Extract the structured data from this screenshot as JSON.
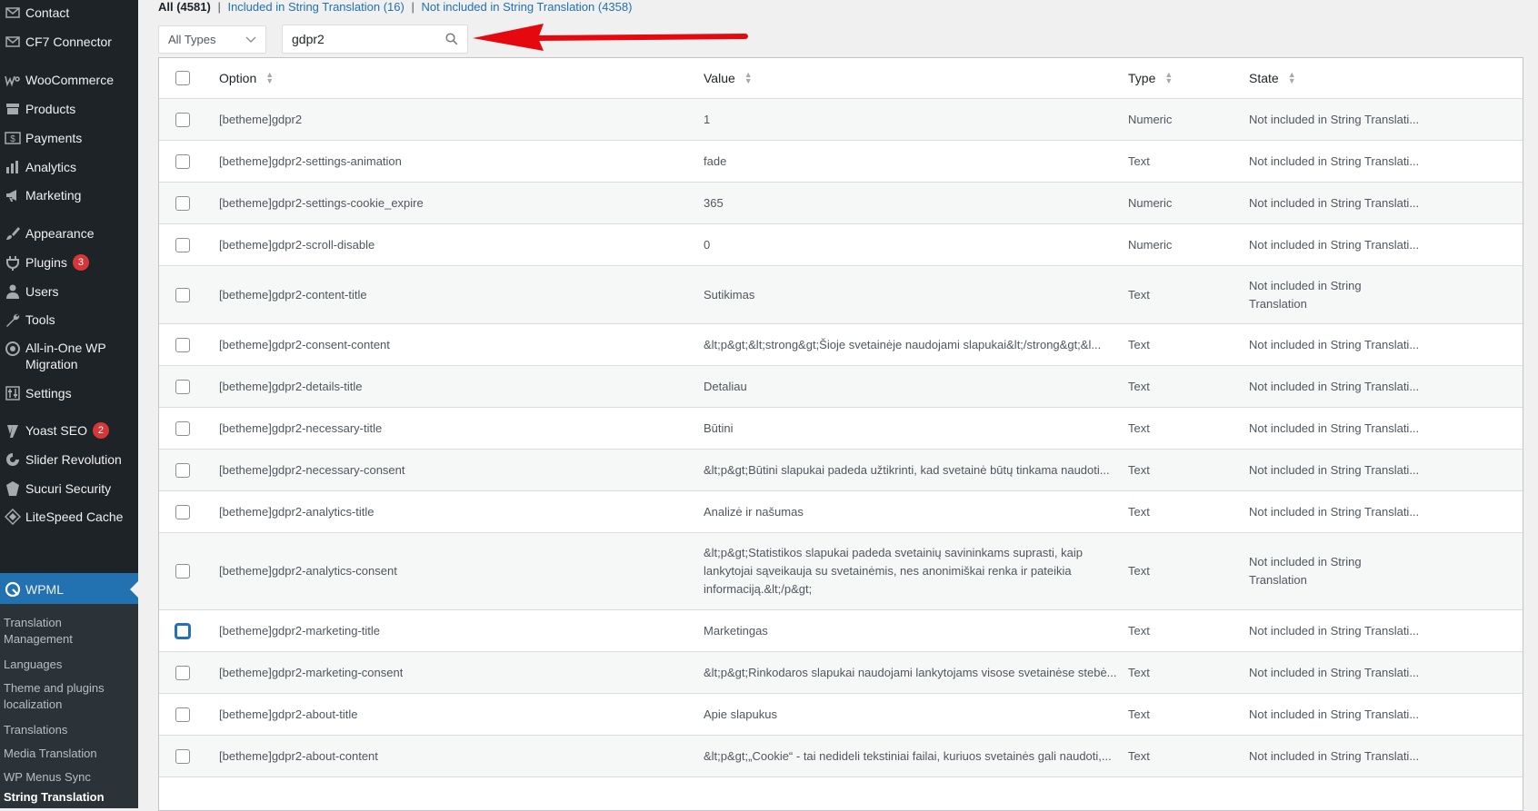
{
  "sidebar": {
    "items": [
      {
        "label": "Contact",
        "icon": "mail-icon"
      },
      {
        "label": "CF7 Connector",
        "icon": "mail-icon"
      },
      {
        "label": "WooCommerce",
        "icon": "woocommerce-icon"
      },
      {
        "label": "Products",
        "icon": "archive-icon"
      },
      {
        "label": "Payments",
        "icon": "dollar-icon"
      },
      {
        "label": "Analytics",
        "icon": "bar-chart-icon"
      },
      {
        "label": "Marketing",
        "icon": "megaphone-icon"
      },
      {
        "label": "Appearance",
        "icon": "paintbrush-icon"
      },
      {
        "label": "Plugins",
        "icon": "plugin-icon",
        "badge": "3"
      },
      {
        "label": "Users",
        "icon": "user-icon"
      },
      {
        "label": "Tools",
        "icon": "wrench-icon"
      },
      {
        "label": "All-in-One WP Migration",
        "icon": "migration-icon"
      },
      {
        "label": "Settings",
        "icon": "settings-icon"
      },
      {
        "label": "Yoast SEO",
        "icon": "yoast-icon",
        "badge": "2"
      },
      {
        "label": "Slider Revolution",
        "icon": "slider-icon"
      },
      {
        "label": "Sucuri Security",
        "icon": "shield-icon"
      },
      {
        "label": "LiteSpeed Cache",
        "icon": "diamond-icon"
      },
      {
        "label": "WPML",
        "icon": "wpml-icon"
      }
    ],
    "submenu": [
      {
        "label": "Translation Management"
      },
      {
        "label": "Languages"
      },
      {
        "label": "Theme and plugins localization"
      },
      {
        "label": "Translations"
      },
      {
        "label": "Media Translation"
      },
      {
        "label": "WP Menus Sync"
      },
      {
        "label": "String Translation"
      }
    ]
  },
  "filters": {
    "all": "All (4581)",
    "sep": "|",
    "included": "Included in String Translation (16)",
    "not_included": "Not included in String Translation (4358)"
  },
  "type_select": {
    "value": "All Types"
  },
  "search": {
    "value": "gdpr2"
  },
  "colors": {
    "accent": "#2271b1",
    "arrow": "#e5090f",
    "badge": "#d63638",
    "sidebar": "#1d2327"
  },
  "table": {
    "headers": {
      "option": "Option",
      "value": "Value",
      "type": "Type",
      "state": "State"
    },
    "rows": [
      {
        "option": "[betheme]gdpr2",
        "value": "1",
        "type": "Numeric",
        "state": "Not included in String Translati..."
      },
      {
        "option": "[betheme]gdpr2-settings-animation",
        "value": "fade",
        "type": "Text",
        "state": "Not included in String Translati..."
      },
      {
        "option": "[betheme]gdpr2-settings-cookie_expire",
        "value": "365",
        "type": "Numeric",
        "state": "Not included in String Translati..."
      },
      {
        "option": "[betheme]gdpr2-scroll-disable",
        "value": "0",
        "type": "Numeric",
        "state": "Not included in String Translati..."
      },
      {
        "option": "[betheme]gdpr2-content-title",
        "value": "Sutikimas",
        "type": "Text",
        "state": "Not included in String Translation"
      },
      {
        "option": "[betheme]gdpr2-consent-content",
        "value": "&lt;p&gt;&lt;strong&gt;Šioje svetainėje naudojami slapukai&lt;/strong&gt;&l...",
        "type": "Text",
        "state": "Not included in String Translati..."
      },
      {
        "option": "[betheme]gdpr2-details-title",
        "value": "Detaliau",
        "type": "Text",
        "state": "Not included in String Translati..."
      },
      {
        "option": "[betheme]gdpr2-necessary-title",
        "value": "Būtini",
        "type": "Text",
        "state": "Not included in String Translati..."
      },
      {
        "option": "[betheme]gdpr2-necessary-consent",
        "value": "&lt;p&gt;Būtini slapukai padeda užtikrinti, kad svetainė būtų tinkama naudoti...",
        "type": "Text",
        "state": "Not included in String Translati..."
      },
      {
        "option": "[betheme]gdpr2-analytics-title",
        "value": "Analizė ir našumas",
        "type": "Text",
        "state": "Not included in String Translati..."
      },
      {
        "option": "[betheme]gdpr2-analytics-consent",
        "value": "&lt;p&gt;Statistikos slapukai padeda svetainių savininkams suprasti, kaip lankytojai sąveikauja su svetainėmis, nes anonimiškai renka ir pateikia informaciją.&lt;/p&gt;",
        "type": "Text",
        "state": "Not included in String Translation"
      },
      {
        "option": "[betheme]gdpr2-marketing-title",
        "value": "Marketingas",
        "type": "Text",
        "state": "Not included in String Translati..."
      },
      {
        "option": "[betheme]gdpr2-marketing-consent",
        "value": "&lt;p&gt;Rinkodaros slapukai naudojami lankytojams visose svetainėse stebė...",
        "type": "Text",
        "state": "Not included in String Translati..."
      },
      {
        "option": "[betheme]gdpr2-about-title",
        "value": "Apie slapukus",
        "type": "Text",
        "state": "Not included in String Translati..."
      },
      {
        "option": "[betheme]gdpr2-about-content",
        "value": "&lt;p&gt;„Cookie“ - tai nedideli tekstiniai failai, kuriuos svetainės gali naudoti,...",
        "type": "Text",
        "state": "Not included in String Translati..."
      }
    ]
  }
}
